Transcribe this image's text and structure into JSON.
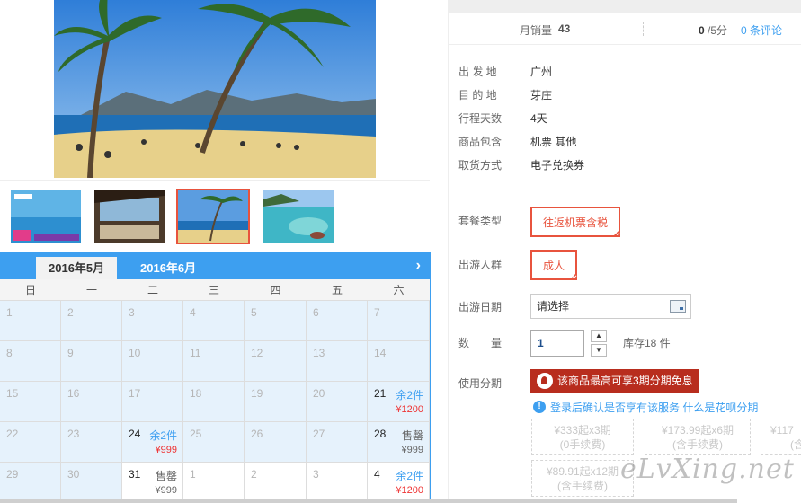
{
  "colors": {
    "accent_blue": "#3d9ff0",
    "accent_red": "#e8533d",
    "banner_red": "#b82d1e"
  },
  "calendar": {
    "months": [
      "2016年5月",
      "2016年6月"
    ],
    "weekdays": [
      "日",
      "一",
      "二",
      "三",
      "四",
      "五",
      "六"
    ],
    "cells": [
      {
        "d": "1"
      },
      {
        "d": "2"
      },
      {
        "d": "3"
      },
      {
        "d": "4"
      },
      {
        "d": "5"
      },
      {
        "d": "6"
      },
      {
        "d": "7"
      },
      {
        "d": "8"
      },
      {
        "d": "9"
      },
      {
        "d": "10"
      },
      {
        "d": "11"
      },
      {
        "d": "12"
      },
      {
        "d": "13"
      },
      {
        "d": "14"
      },
      {
        "d": "15"
      },
      {
        "d": "16"
      },
      {
        "d": "17"
      },
      {
        "d": "18"
      },
      {
        "d": "19"
      },
      {
        "d": "20"
      },
      {
        "d": "21",
        "st": "余2件",
        "pr": "¥1200"
      },
      {
        "d": "22"
      },
      {
        "d": "23"
      },
      {
        "d": "24",
        "st": "余2件",
        "pr": "¥999"
      },
      {
        "d": "25"
      },
      {
        "d": "26"
      },
      {
        "d": "27"
      },
      {
        "d": "28",
        "st": "售罄",
        "pr": "¥999",
        "sold": true
      },
      {
        "d": "29"
      },
      {
        "d": "30"
      },
      {
        "d": "31",
        "st": "售罄",
        "pr": "¥999",
        "sold": true,
        "white": true
      },
      {
        "d": "1",
        "white": true
      },
      {
        "d": "2",
        "white": true
      },
      {
        "d": "3",
        "white": true
      },
      {
        "d": "4",
        "st": "余2件",
        "pr": "¥1200",
        "white": true
      }
    ]
  },
  "stats": {
    "sales_label": "月销量",
    "sales_value": "43",
    "score_value": "0",
    "score_suffix": "/5分",
    "comments": "0 条评论"
  },
  "info": [
    {
      "label": "出 发 地",
      "value": "广州"
    },
    {
      "label": "目 的 地",
      "value": "芽庄"
    },
    {
      "label": "行程天数",
      "value": "4天"
    },
    {
      "label": "商品包含",
      "value": "机票  其他"
    },
    {
      "label": "取货方式",
      "value": "电子兑换券"
    }
  ],
  "options": {
    "package_label": "套餐类型",
    "package_value": "往返机票含税",
    "group_label": "出游人群",
    "group_value": "成人",
    "date_label": "出游日期",
    "date_placeholder": "请选择",
    "qty_label": "数　　量",
    "qty_value": "1",
    "stock": "库存18 件",
    "installment_label": "使用分期",
    "installment_banner": "该商品最高可享3期分期免息",
    "notice_text": "登录后确认是否享有该服务",
    "notice_link": "什么是花呗分期"
  },
  "plans": [
    {
      "line1": "¥333起x3期",
      "line2": "(0手续费)"
    },
    {
      "line1": "¥173.99起x6期",
      "line2": "(含手续费)"
    },
    {
      "line1": "¥117",
      "line2": "(含"
    },
    {
      "line1": "¥89.91起x12期",
      "line2": "(含手续费)"
    }
  ],
  "watermark": "eLvXing.net"
}
